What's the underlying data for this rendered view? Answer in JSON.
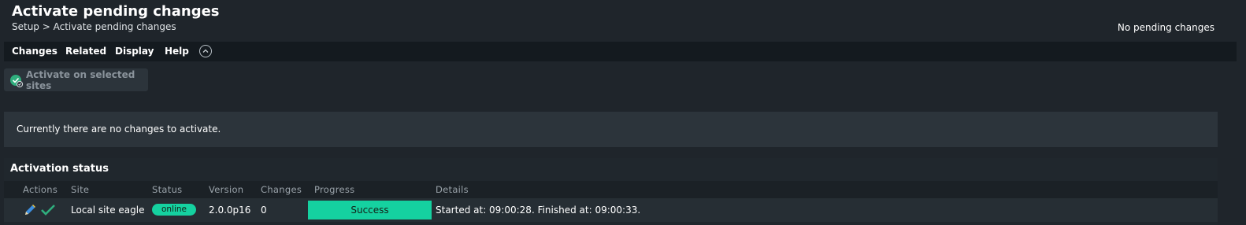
{
  "header": {
    "title": "Activate pending changes",
    "breadcrumb": "Setup > Activate pending changes",
    "pending_status": "No pending changes"
  },
  "menu": {
    "items": [
      "Changes",
      "Related",
      "Display",
      "Help"
    ],
    "collapse_icon": "chevron-up-circle-icon"
  },
  "toolbar": {
    "activate_label": "Activate on selected sites",
    "activate_icon": "activate-check-icon"
  },
  "info": {
    "message": "Currently there are no changes to activate."
  },
  "activation_status": {
    "heading": "Activation status",
    "columns": [
      "Actions",
      "Site",
      "Status",
      "Version",
      "Changes",
      "Progress",
      "Details"
    ],
    "rows": [
      {
        "site": "Local site eagle",
        "status": "online",
        "version": "2.0.0p16",
        "changes": "0",
        "progress_label": "Success",
        "progress_fraction": 1.0,
        "details": "Started at: 09:00:28. Finished at: 09:00:33."
      }
    ]
  },
  "colors": {
    "accent_green": "#15d1a0",
    "background": "#1f252b",
    "menubar": "#141a1f"
  }
}
